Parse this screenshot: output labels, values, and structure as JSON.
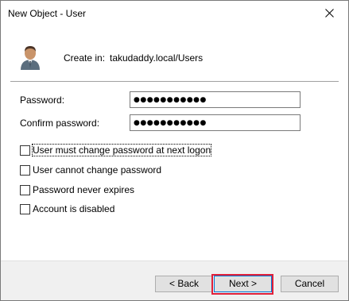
{
  "window": {
    "title": "New Object - User",
    "close_icon": "close-icon"
  },
  "header": {
    "create_in_label": "Create in:",
    "create_in_path": "takudaddy.local/Users",
    "icon": "user-icon"
  },
  "form": {
    "password_label": "Password:",
    "password_value": "●●●●●●●●●●●",
    "confirm_label": "Confirm password:",
    "confirm_value": "●●●●●●●●●●●"
  },
  "options": [
    {
      "label": "User must change password at next logon",
      "checked": false
    },
    {
      "label": "User cannot change password",
      "checked": false
    },
    {
      "label": "Password never expires",
      "checked": false
    },
    {
      "label": "Account is disabled",
      "checked": false
    }
  ],
  "buttons": {
    "back": "< Back",
    "next": "Next >",
    "cancel": "Cancel"
  },
  "colors": {
    "highlight": "#e0203a",
    "accent": "#0078d7"
  }
}
